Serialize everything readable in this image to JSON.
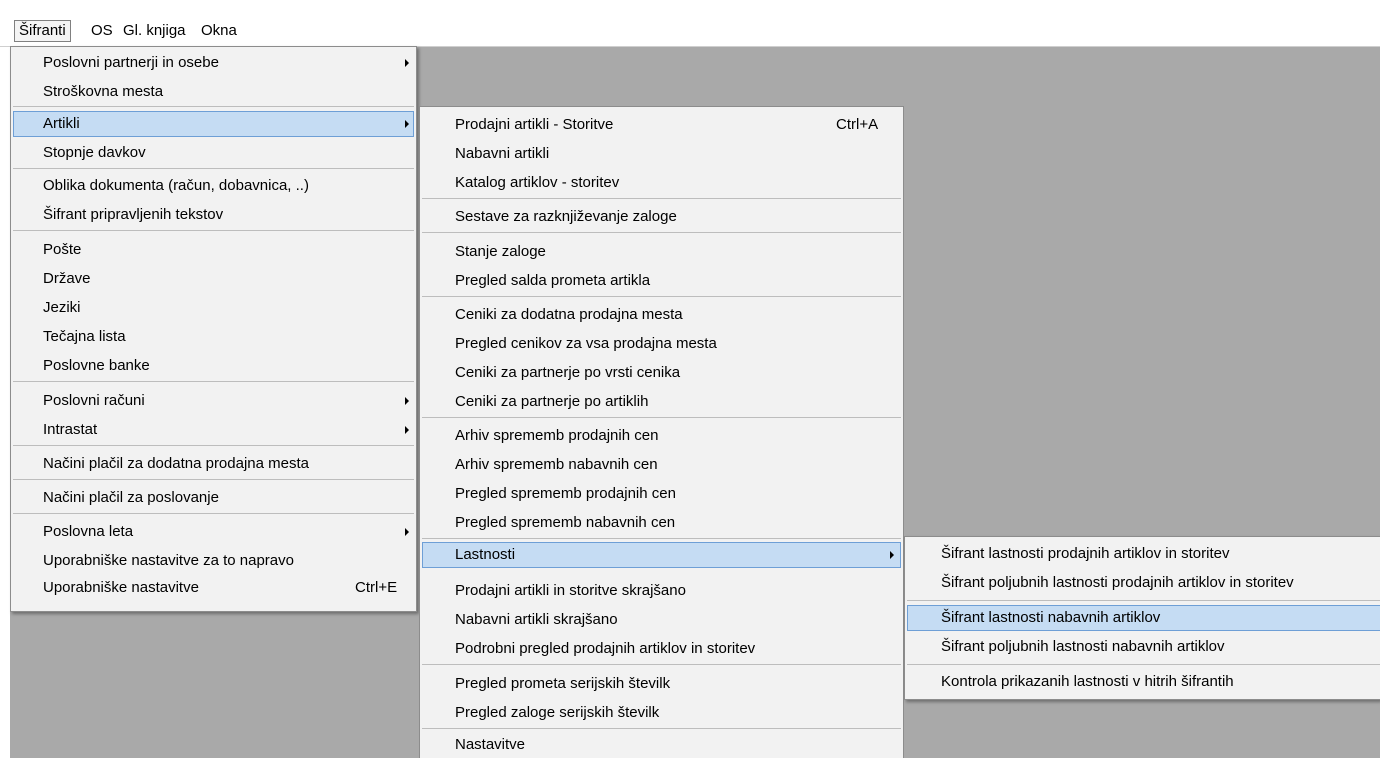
{
  "menubar": {
    "items": [
      "Šifranti",
      "OS",
      "Gl. knjiga",
      "Okna"
    ]
  },
  "menu1": {
    "items": [
      {
        "label": "Poslovni partnerji in osebe",
        "submenu": true
      },
      {
        "label": "Stroškovna mesta"
      },
      {
        "label": "Artikli",
        "submenu": true,
        "selected": true
      },
      {
        "label": "Stopnje davkov"
      },
      {
        "label": "Oblika dokumenta (račun, dobavnica, ..)"
      },
      {
        "label": "Šifrant pripravljenih tekstov"
      },
      {
        "label": "Pošte"
      },
      {
        "label": "Države"
      },
      {
        "label": "Jeziki"
      },
      {
        "label": "Tečajna lista"
      },
      {
        "label": "Poslovne banke"
      },
      {
        "label": "Poslovni računi",
        "submenu": true
      },
      {
        "label": "Intrastat",
        "submenu": true
      },
      {
        "label": "Načini plačil za dodatna prodajna mesta"
      },
      {
        "label": "Načini plačil za poslovanje"
      },
      {
        "label": "Poslovna leta",
        "submenu": true
      },
      {
        "label": "Uporabniške nastavitve za to napravo"
      },
      {
        "label": "Uporabniške nastavitve",
        "shortcut": "Ctrl+E"
      }
    ]
  },
  "menu2": {
    "items": [
      {
        "label": "Prodajni artikli - Storitve",
        "shortcut": "Ctrl+A"
      },
      {
        "label": "Nabavni artikli"
      },
      {
        "label": "Katalog artiklov - storitev"
      },
      {
        "label": "Sestave za razknjiževanje zaloge"
      },
      {
        "label": "Stanje zaloge"
      },
      {
        "label": "Pregled salda prometa artikla"
      },
      {
        "label": "Ceniki za dodatna prodajna mesta"
      },
      {
        "label": "Pregled cenikov za vsa prodajna mesta"
      },
      {
        "label": "Ceniki za partnerje po vrsti cenika"
      },
      {
        "label": "Ceniki za partnerje po artiklih"
      },
      {
        "label": "Arhiv sprememb prodajnih cen"
      },
      {
        "label": "Arhiv sprememb nabavnih cen"
      },
      {
        "label": "Pregled sprememb prodajnih cen"
      },
      {
        "label": "Pregled sprememb nabavnih cen"
      },
      {
        "label": "Lastnosti",
        "submenu": true,
        "selected": true
      },
      {
        "label": "Prodajni artikli in storitve skrajšano"
      },
      {
        "label": "Nabavni artikli skrajšano"
      },
      {
        "label": "Podrobni pregled prodajnih artiklov in storitev"
      },
      {
        "label": "Pregled prometa serijskih številk"
      },
      {
        "label": "Pregled zaloge serijskih številk"
      },
      {
        "label": "Nastavitve"
      }
    ]
  },
  "menu3": {
    "items": [
      {
        "label": "Šifrant lastnosti prodajnih artiklov in storitev"
      },
      {
        "label": "Šifrant poljubnih lastnosti prodajnih artiklov in storitev"
      },
      {
        "label": "Šifrant lastnosti nabavnih artiklov",
        "selected": true
      },
      {
        "label": "Šifrant poljubnih lastnosti nabavnih artiklov"
      },
      {
        "label": "Kontrola prikazanih lastnosti v hitrih šifrantih"
      }
    ]
  },
  "colors": {
    "workspace": "#a9a9a9",
    "menu_bg": "#f2f2f2",
    "highlight": "#c5dcf3",
    "highlight_border": "#6e9fd6"
  }
}
